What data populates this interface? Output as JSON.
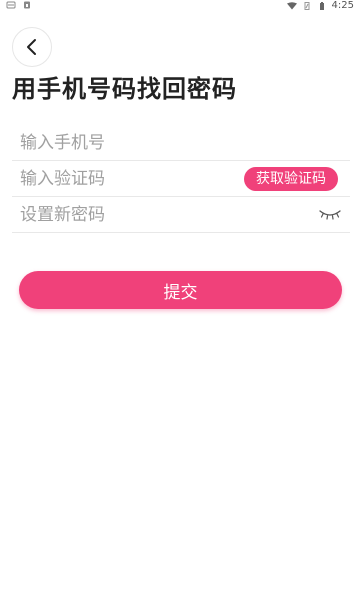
{
  "status_bar": {
    "time": "4:25",
    "left_icons": [
      "notification-icon",
      "sim-icon"
    ],
    "right_icons": [
      "wifi-icon",
      "battery-saver-icon",
      "battery-icon"
    ]
  },
  "header": {
    "back_icon": "chevron-left-icon",
    "title": "用手机号码找回密码"
  },
  "form": {
    "phone_placeholder": "输入手机号",
    "code_placeholder": "输入验证码",
    "get_code_label": "获取验证码",
    "password_placeholder": "设置新密码",
    "password_toggle_icon": "eye-closed-icon"
  },
  "submit_label": "提交",
  "colors": {
    "accent": "#f0417a",
    "divider": "#e8e8e8",
    "placeholder": "#a0a0a0"
  }
}
